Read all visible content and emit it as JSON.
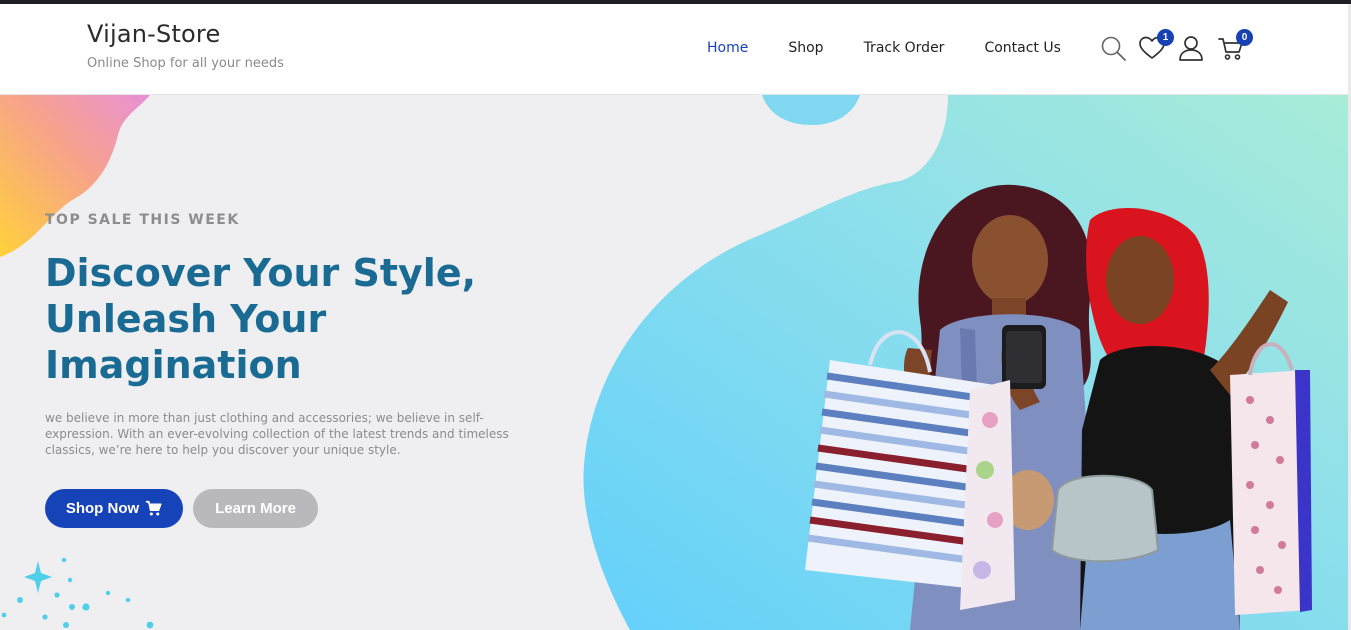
{
  "header": {
    "brand_name": "Vijan-Store",
    "brand_tagline": "Online Shop for all your needs",
    "nav": [
      {
        "label": "Home",
        "active": true
      },
      {
        "label": "Shop",
        "active": false
      },
      {
        "label": "Track Order",
        "active": false
      },
      {
        "label": "Contact Us",
        "active": false
      }
    ],
    "icons": {
      "search": "search-icon",
      "wishlist": "heart-icon",
      "account": "user-icon",
      "cart": "cart-icon"
    },
    "wishlist_count": "1",
    "cart_count": "0"
  },
  "hero": {
    "eyebrow": "TOP SALE THIS WEEK",
    "headline": "Discover Your Style, Unleash Your Imagination",
    "description": "we believe in more than just clothing and accessories; we believe in self-expression. With an ever-evolving collection of the latest trends and timeless classics, we’re here to help you discover your unique style.",
    "primary_button": "Shop Now",
    "secondary_button": "Learn More",
    "image": "two-women-with-shopping-bags"
  },
  "colors": {
    "accent": "#1643b8",
    "headline": "#1a6b94",
    "badge": "#1740b0",
    "secondary_button": "#b9b9bd",
    "hero_background": "#efeff1",
    "blob_blue": "#6fd4f5",
    "blob_mint": "#a5ebdb"
  }
}
